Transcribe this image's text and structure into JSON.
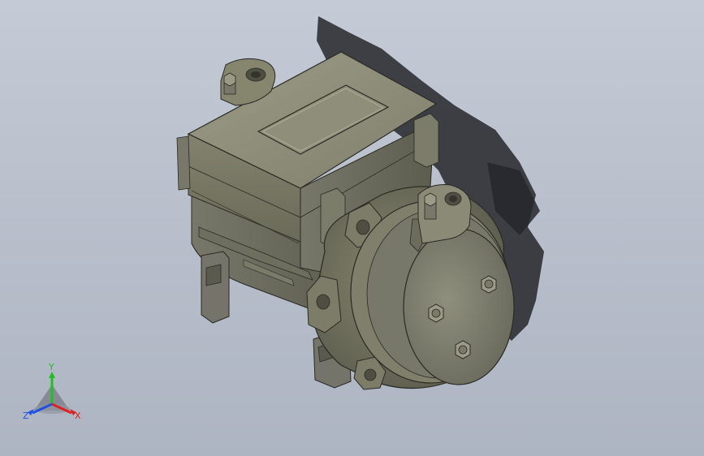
{
  "viewport": {
    "background_top": "#c4cad6",
    "background_bottom": "#aeb5c2"
  },
  "model": {
    "name": "electric-scroll-compressor",
    "body_color": "#8a8a77",
    "body_dark": "#5f5f50",
    "edge_color": "#2a2a24",
    "shadow_color": "#26272b"
  },
  "triad": {
    "x_label": "X",
    "y_label": "Y",
    "z_label": "Z",
    "x_color": "#e02020",
    "y_color": "#20c020",
    "z_color": "#2050e0"
  }
}
